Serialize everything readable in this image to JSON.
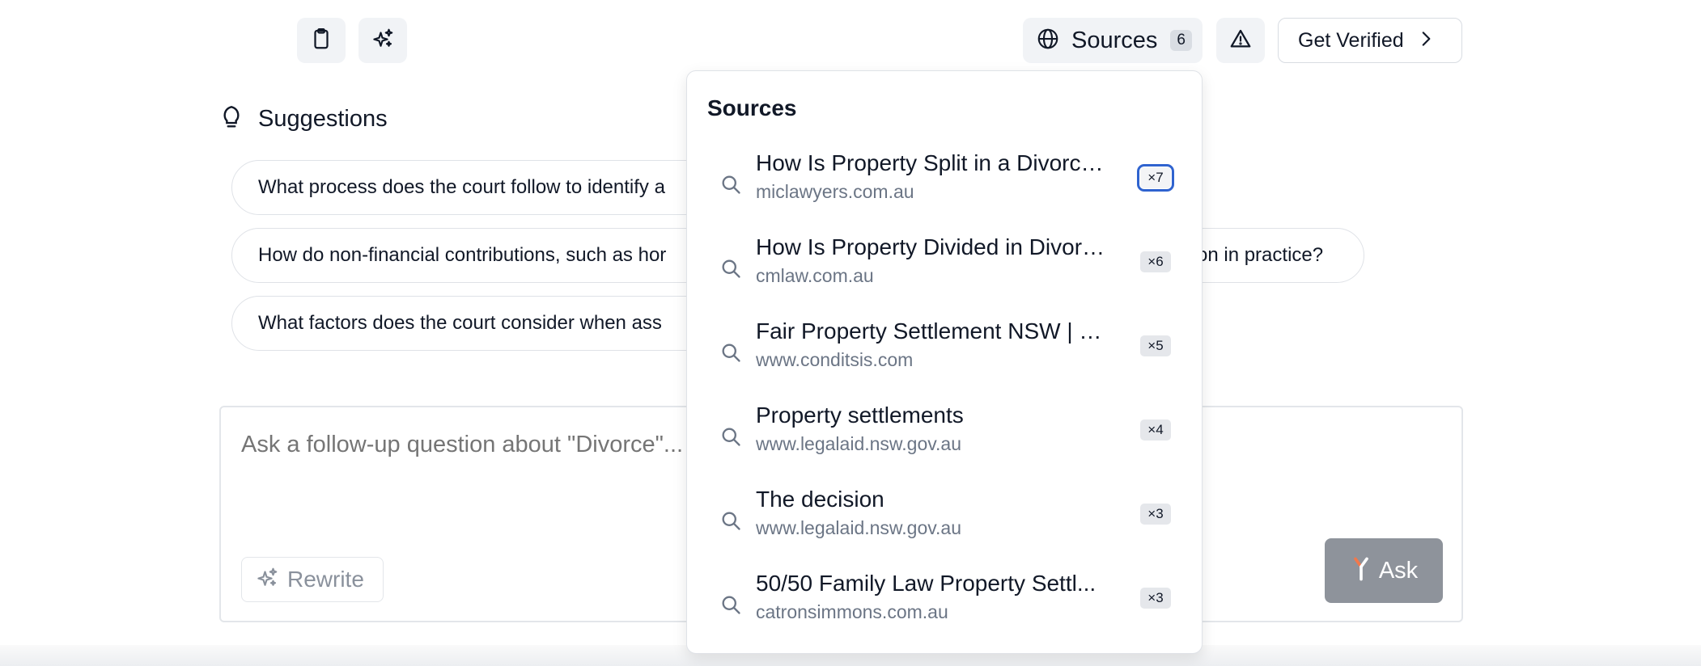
{
  "toolbar": {
    "sources_label": "Sources",
    "sources_count": "6",
    "get_verified_label": "Get Verified"
  },
  "suggestions": {
    "title": "Suggestions",
    "items": [
      "What process does the court follow to identify a",
      "How do non-financial contributions, such as hor",
      "What factors does the court consider when ass"
    ],
    "item2_tail": "on in practice?"
  },
  "composer": {
    "placeholder": "Ask a follow-up question about \"Divorce\"...",
    "rewrite_label": "Rewrite",
    "ask_label": "Ask"
  },
  "sources_panel": {
    "title": "Sources",
    "items": [
      {
        "title": "How Is Property Split in a Divorce ...",
        "domain": "miclawyers.com.au",
        "count": "×7"
      },
      {
        "title": "How Is Property Divided in Divorc...",
        "domain": "cmlaw.com.au",
        "count": "×6"
      },
      {
        "title": "Fair Property Settlement NSW | K...",
        "domain": "www.conditsis.com",
        "count": "×5"
      },
      {
        "title": "Property settlements",
        "domain": "www.legalaid.nsw.gov.au",
        "count": "×4"
      },
      {
        "title": "The decision",
        "domain": "www.legalaid.nsw.gov.au",
        "count": "×3"
      },
      {
        "title": "50/50 Family Law Property Settl...",
        "domain": "catronsimmons.com.au",
        "count": "×3"
      }
    ]
  },
  "icons": {
    "clipboard": "clipboard-icon",
    "sparkles": "sparkles-icon",
    "globe": "globe-icon",
    "warning": "warning-triangle-icon",
    "chevron": "chevron-right-icon",
    "lightbulb": "lightbulb-icon",
    "search": "search-icon",
    "ask": "ask-logo-icon"
  },
  "colors": {
    "ask_button": "#8e939b",
    "focus_ring": "#2f63cf",
    "ask_logo_accent": "#f2784b"
  }
}
